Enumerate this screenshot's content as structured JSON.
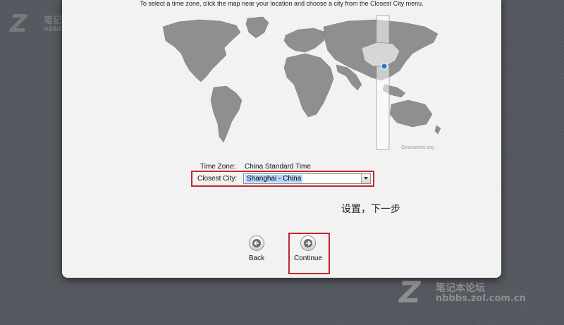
{
  "instruction": "To select a time zone, click the map near your location and choose a city from the Closest City menu.",
  "map": {
    "credit": "Geonames.org",
    "land_color": "#8f8f8f",
    "highlight_band_color": "#ffffff",
    "selected_region_color": "#d6d6d6",
    "pin_color": "#2f6fd6"
  },
  "time_zone": {
    "label": "Time Zone:",
    "value": "China Standard Time"
  },
  "closest_city": {
    "label": "Closest City:",
    "value": "Shanghai - China"
  },
  "annotation": "设置，下一步",
  "buttons": {
    "back": "Back",
    "continue": "Continue"
  },
  "watermark": {
    "brand_cn": "笔记本论坛",
    "url_top": "nbbbs.zol.com.cn",
    "url_bottom": "nbbbs.zol.com.cn"
  },
  "colors": {
    "highlight_border": "#c0272d",
    "selection": "#b5d5ff"
  }
}
